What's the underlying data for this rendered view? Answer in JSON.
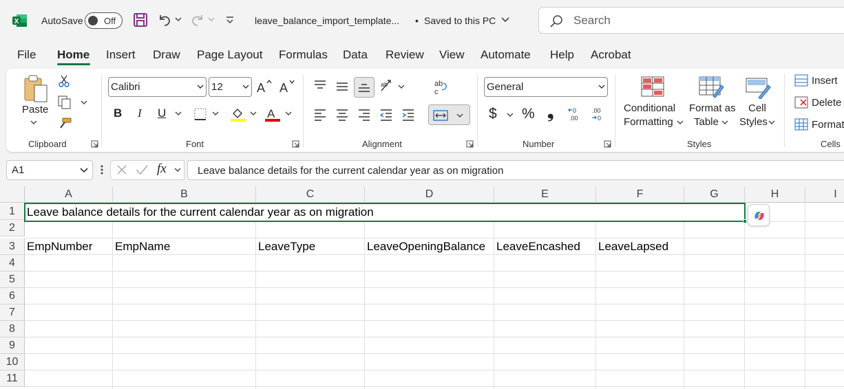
{
  "titlebar": {
    "autosave_label": "AutoSave",
    "autosave_state": "Off",
    "filename": "leave_balance_import_template...",
    "save_status": "Saved to this PC",
    "search_placeholder": "Search"
  },
  "menu": {
    "tabs": [
      "File",
      "Home",
      "Insert",
      "Draw",
      "Page Layout",
      "Formulas",
      "Data",
      "Review",
      "View",
      "Automate",
      "Help",
      "Acrobat"
    ],
    "active": "Home"
  },
  "ribbon": {
    "clipboard": {
      "label": "Clipboard",
      "paste": "Paste"
    },
    "font": {
      "label": "Font",
      "family": "Calibri",
      "size": "12",
      "bold": "B",
      "italic": "I",
      "underline": "U",
      "grow": "A^",
      "shrink": "A˅",
      "color_char": "A"
    },
    "alignment": {
      "label": "Alignment"
    },
    "number": {
      "label": "Number",
      "format": "General",
      "currency": "$",
      "percent": "%",
      "comma": "❟",
      "inc_decimal": ".00",
      "dec_decimal": ".00"
    },
    "styles": {
      "label": "Styles",
      "conditional_1": "Conditional",
      "conditional_2": "Formatting",
      "table_1": "Format as",
      "table_2": "Table",
      "cell_1": "Cell",
      "cell_2": "Styles"
    },
    "cells": {
      "label": "Cells",
      "insert": "Insert",
      "delete": "Delete",
      "format": "Format"
    },
    "colors": {
      "fill": "#ffff00",
      "font": "#e00000",
      "accent": "#107c41"
    }
  },
  "formula_bar": {
    "name_box": "A1",
    "fx": "fx",
    "content": "Leave balance details for the current calendar year as on migration"
  },
  "sheet": {
    "columns": [
      "A",
      "B",
      "C",
      "D",
      "E",
      "F",
      "G",
      "H",
      "I"
    ],
    "rows": [
      "1",
      "2",
      "3",
      "4",
      "5",
      "6",
      "7",
      "8",
      "9",
      "10",
      "11"
    ],
    "a1": "Leave balance details for the current calendar year as on migration",
    "headers": [
      "EmpNumber",
      "EmpName",
      "LeaveType",
      "LeaveOpeningBalance",
      "LeaveEncashed",
      "LeaveLapsed"
    ]
  }
}
